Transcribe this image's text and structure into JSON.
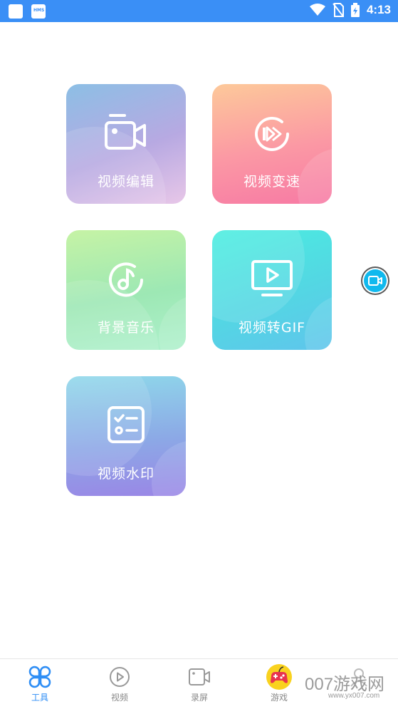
{
  "status_bar": {
    "time": "4:13",
    "left_icons": [
      "app-square-icon",
      "hms-icon"
    ],
    "hms_label": "HMS",
    "right_icons": [
      "wifi-icon",
      "no-sim-icon",
      "battery-charging-icon"
    ]
  },
  "tools": [
    {
      "label": "视频编辑",
      "icon": "video-camera-icon"
    },
    {
      "label": "视频变速",
      "icon": "fast-forward-circle-icon"
    },
    {
      "label": "背景音乐",
      "icon": "music-note-icon"
    },
    {
      "label": "视频转GIF",
      "icon": "play-screen-icon"
    },
    {
      "label": "视频水印",
      "icon": "checklist-icon"
    }
  ],
  "floating_button": {
    "icon": "record-camera-icon"
  },
  "bottom_nav": {
    "items": [
      {
        "label": "工具",
        "icon": "four-petal-icon",
        "active": true
      },
      {
        "label": "视频",
        "icon": "play-circle-icon",
        "active": false
      },
      {
        "label": "录屏",
        "icon": "camera-icon",
        "active": false
      },
      {
        "label": "游戏",
        "icon": "game-controller-icon",
        "active": false
      }
    ],
    "accent_color": "#2f8ef5"
  },
  "watermark": {
    "text": "007游戏网",
    "subtext": "www.yx007.com"
  }
}
